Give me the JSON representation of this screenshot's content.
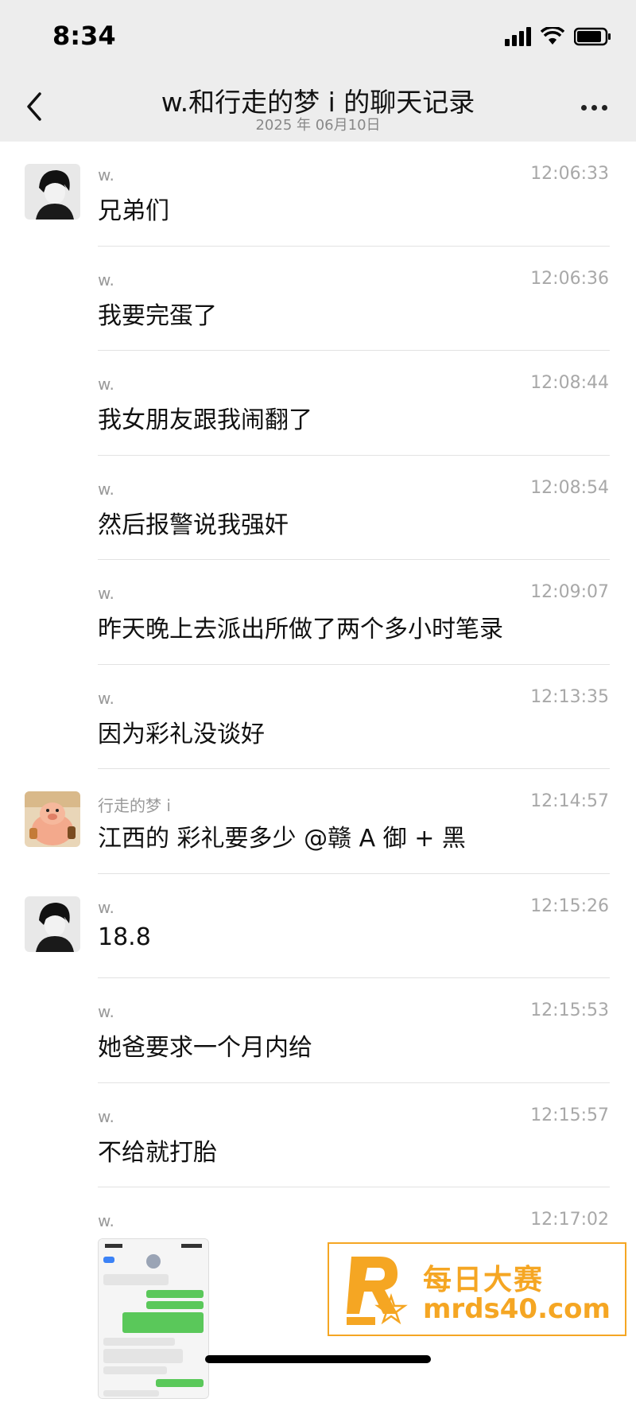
{
  "status": {
    "time": "8:34"
  },
  "nav": {
    "title": "w.和行走的梦 i 的聊天记录",
    "subtitle": "2025 年 06月10日"
  },
  "messages": [
    {
      "sender": "w.",
      "time": "12:06:33",
      "text": "兄弟们",
      "avatar": "black-hair-avatar"
    },
    {
      "sender": "w.",
      "time": "12:06:36",
      "text": "我要完蛋了"
    },
    {
      "sender": "w.",
      "time": "12:08:44",
      "text": "我女朋友跟我闹翻了"
    },
    {
      "sender": "w.",
      "time": "12:08:54",
      "text": "然后报警说我强奸"
    },
    {
      "sender": "w.",
      "time": "12:09:07",
      "text": "昨天晚上去派出所做了两个多小时笔录"
    },
    {
      "sender": "w.",
      "time": "12:13:35",
      "text": "因为彩礼没谈好"
    },
    {
      "sender": "行走的梦 i",
      "time": "12:14:57",
      "text": "江西的 彩礼要多少 @赣 A 御 + 黑",
      "avatar": "cartoon-pig-avatar"
    },
    {
      "sender": "w.",
      "time": "12:15:26",
      "text": "18.8",
      "avatar": "black-hair-avatar"
    },
    {
      "sender": "w.",
      "time": "12:15:53",
      "text": "她爸要求一个月内给"
    },
    {
      "sender": "w.",
      "time": "12:15:57",
      "text": "不给就打胎"
    },
    {
      "sender": "w.",
      "time": "12:17:02",
      "text": ""
    }
  ],
  "watermark": {
    "line1": "每日大赛",
    "line2": "mrds40.com"
  },
  "colors": {
    "header_bg": "#ededed",
    "watermark": "#f5a623",
    "divider": "#e2e2e2"
  }
}
